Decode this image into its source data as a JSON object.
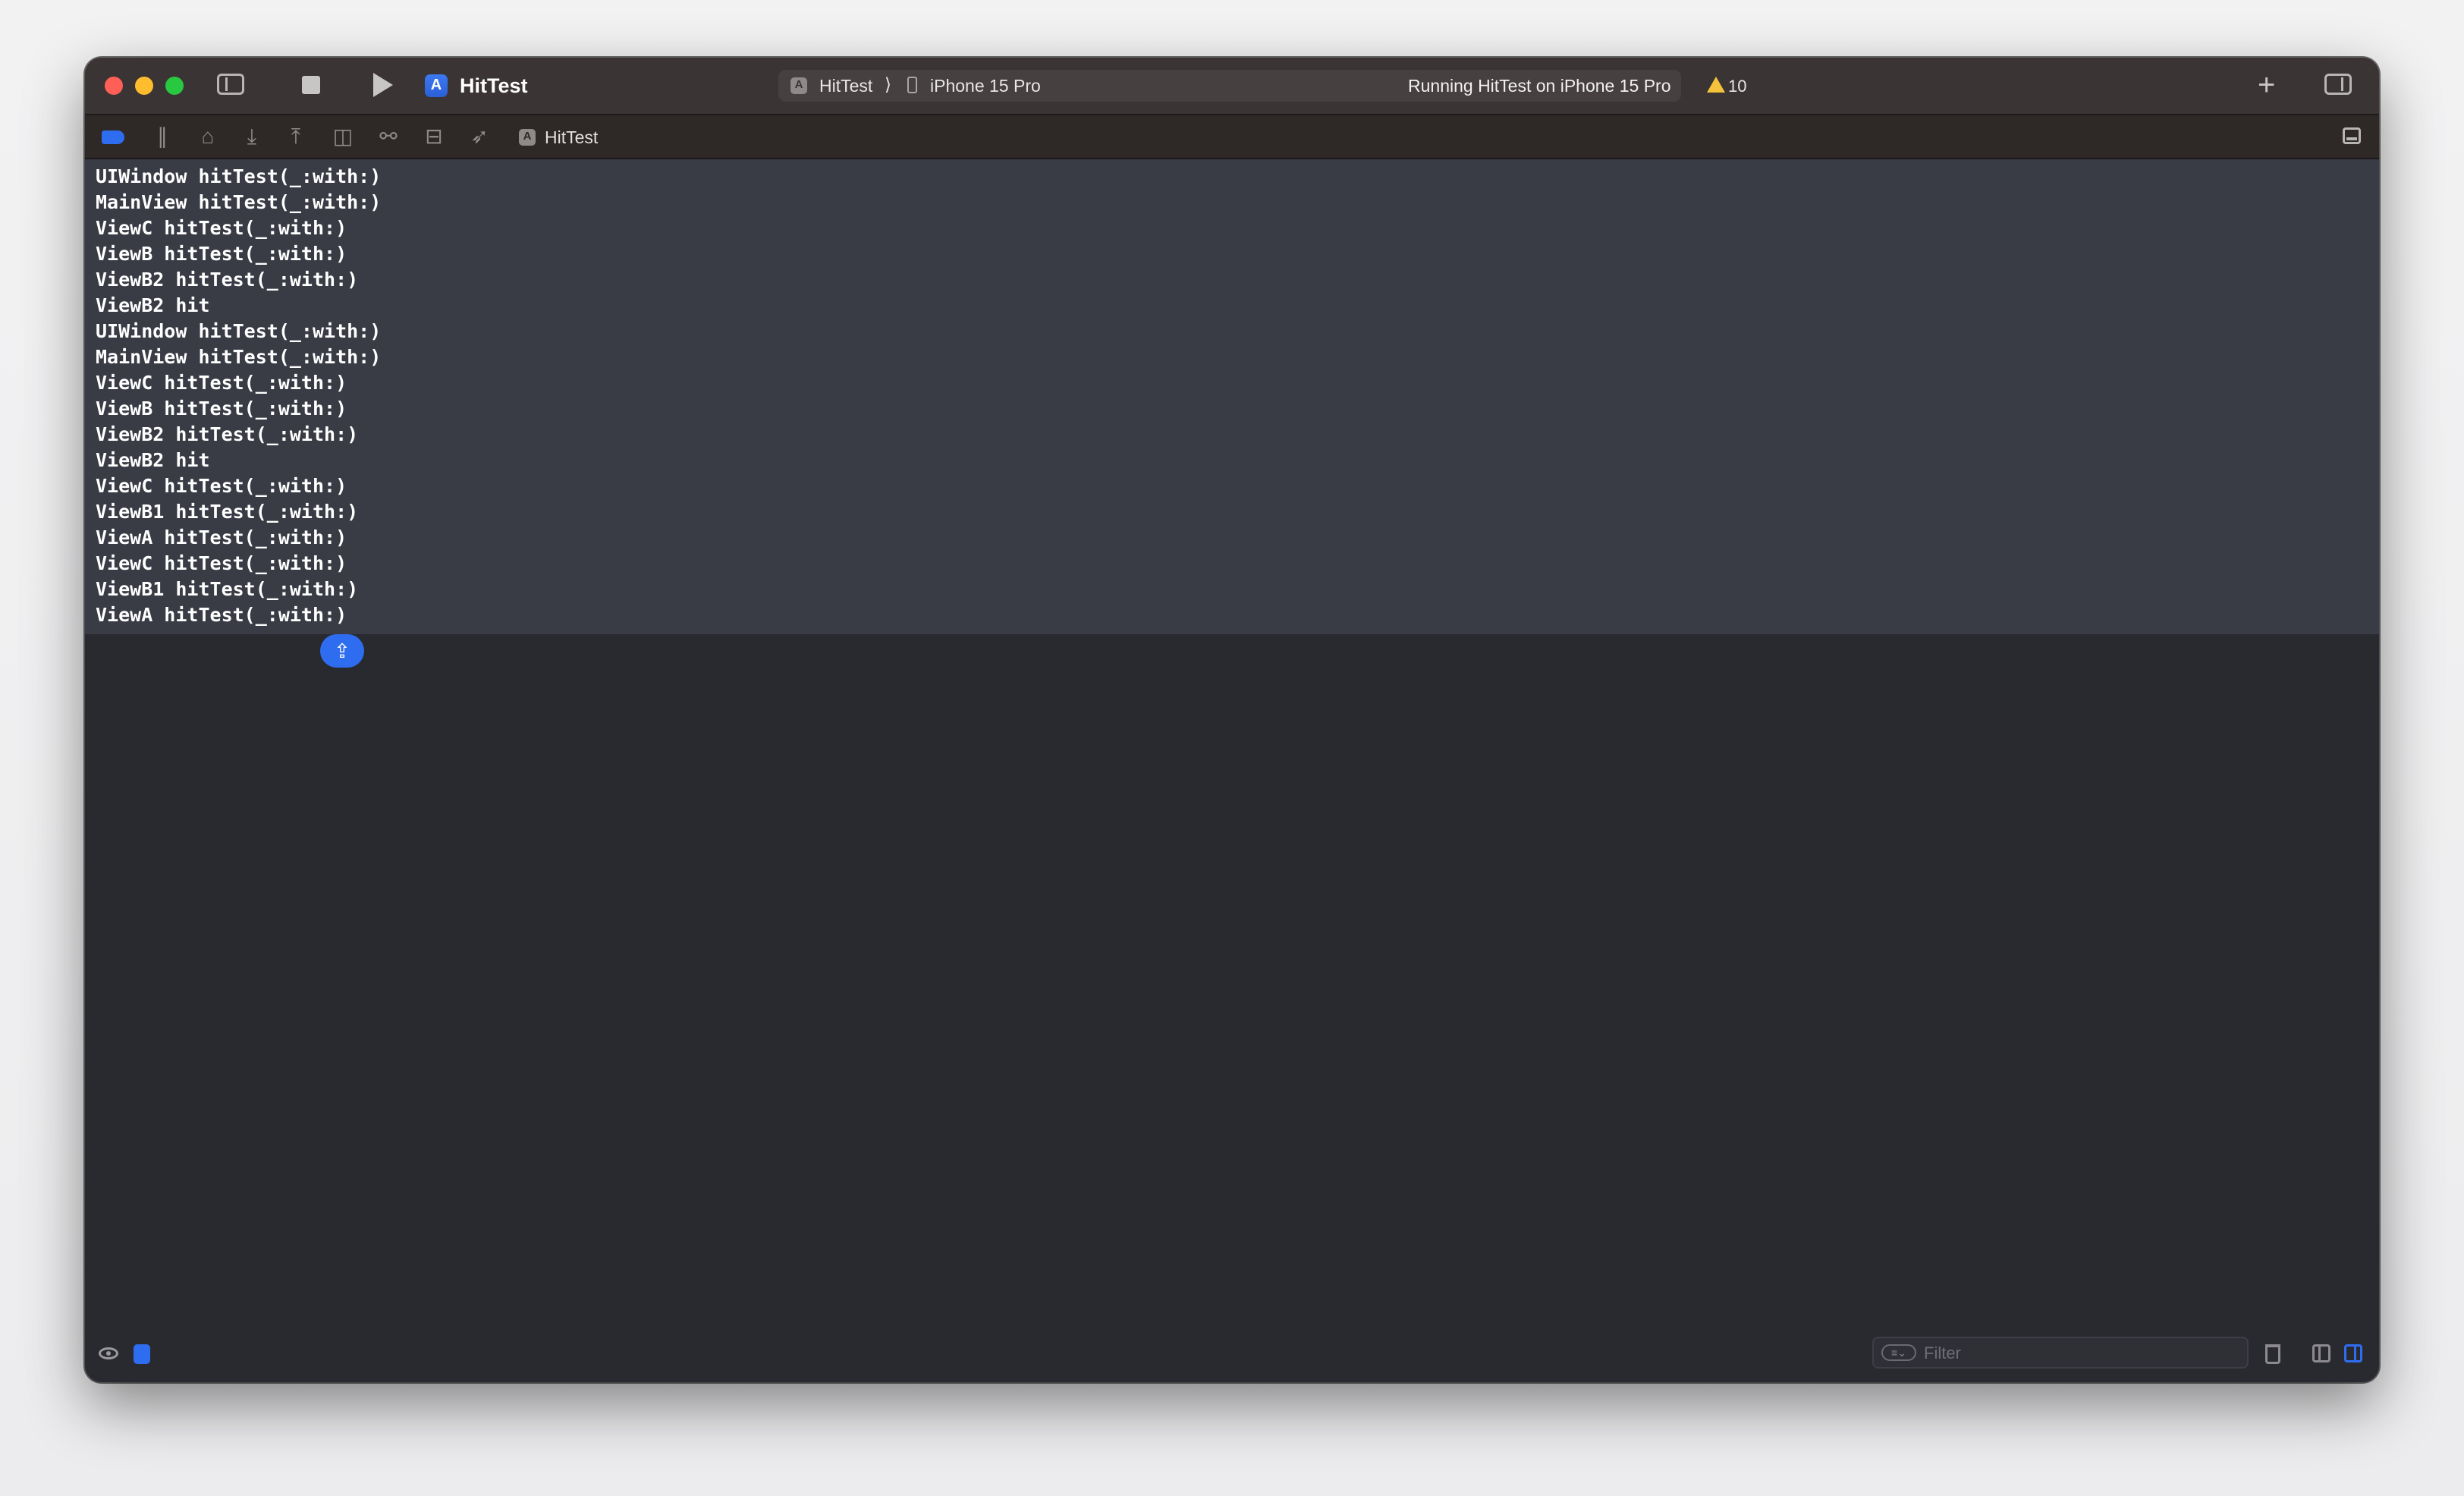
{
  "toolbar": {
    "app_title": "HitTest",
    "scheme": {
      "app": "HitTest",
      "separator": "⟩",
      "device": "iPhone 15 Pro"
    },
    "status": "Running HitTest on iPhone 15 Pro",
    "warning_count": "10",
    "add_label": "+"
  },
  "debug_bar": {
    "target_name": "HitTest",
    "icons": [
      "breakpoints-icon",
      "pause-icon",
      "step-over-icon",
      "step-into-icon",
      "step-out-icon",
      "view-hierarchy-icon",
      "memory-graph-icon",
      "environment-overrides-icon",
      "location-icon"
    ]
  },
  "console": {
    "lines": [
      "UIWindow hitTest(_:with:)",
      "MainView hitTest(_:with:)",
      "ViewC hitTest(_:with:)",
      "ViewB hitTest(_:with:)",
      "ViewB2 hitTest(_:with:)",
      "ViewB2 hit",
      "UIWindow hitTest(_:with:)",
      "MainView hitTest(_:with:)",
      "ViewC hitTest(_:with:)",
      "ViewB hitTest(_:with:)",
      "ViewB2 hitTest(_:with:)",
      "ViewB2 hit",
      "ViewC hitTest(_:with:)",
      "ViewB1 hitTest(_:with:)",
      "ViewA hitTest(_:with:)",
      "ViewC hitTest(_:with:)",
      "ViewB1 hitTest(_:with:)",
      "ViewA hitTest(_:with:)"
    ]
  },
  "bottom": {
    "filter_placeholder": "Filter"
  },
  "colors": {
    "accent": "#2f6df0",
    "warning": "#f5c33b"
  }
}
